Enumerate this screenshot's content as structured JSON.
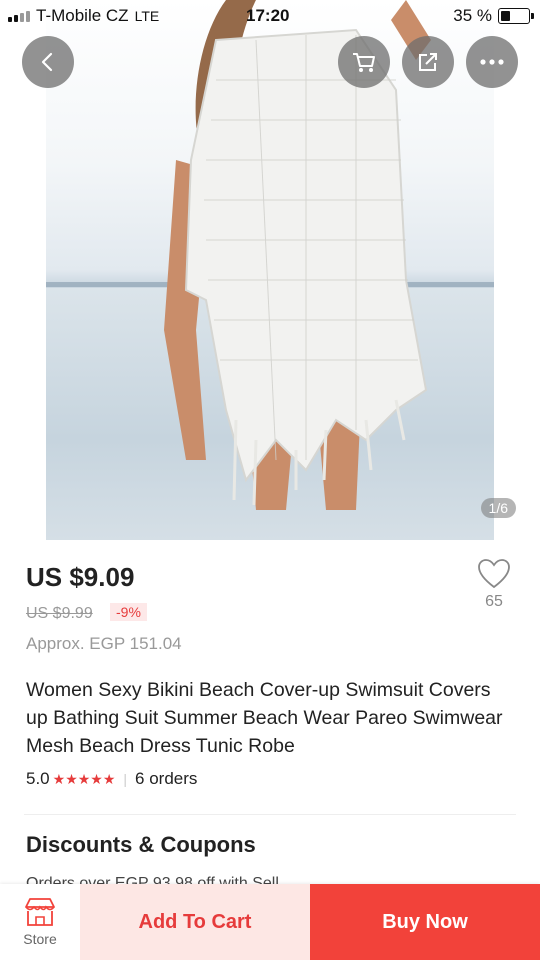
{
  "status_bar": {
    "carrier": "T-Mobile CZ",
    "network": "LTE",
    "time": "17:20",
    "battery": "35 %",
    "battery_level": 0.35
  },
  "gallery": {
    "counter": "1/6"
  },
  "header_icons": {
    "back": "back-arrow-icon",
    "cart": "cart-icon",
    "share": "share-icon",
    "more": "more-icon"
  },
  "product": {
    "price": "US $9.09",
    "original_price": "US $9.99",
    "discount": "-9%",
    "approx_price": "Approx. EGP 151.04",
    "wishlist_count": "65",
    "title": "Women Sexy Bikini Beach Cover-up Swimsuit Covers up Bathing Suit Summer Beach Wear Pareo Swimwear Mesh Beach Dress Tunic Robe",
    "rating": "5.0",
    "stars": "★★★★★",
    "orders": "6 orders"
  },
  "sections": {
    "discounts_title": "Discounts & Coupons",
    "coupon_peek": "Orders over EGP 93.98 off with Sell"
  },
  "bottom_bar": {
    "store_label": "Store",
    "add_to_cart": "Add To Cart",
    "buy_now": "Buy Now"
  },
  "colors": {
    "accent": "#f2423a",
    "accent_light": "#fde7e4",
    "star": "#e63b3b"
  }
}
